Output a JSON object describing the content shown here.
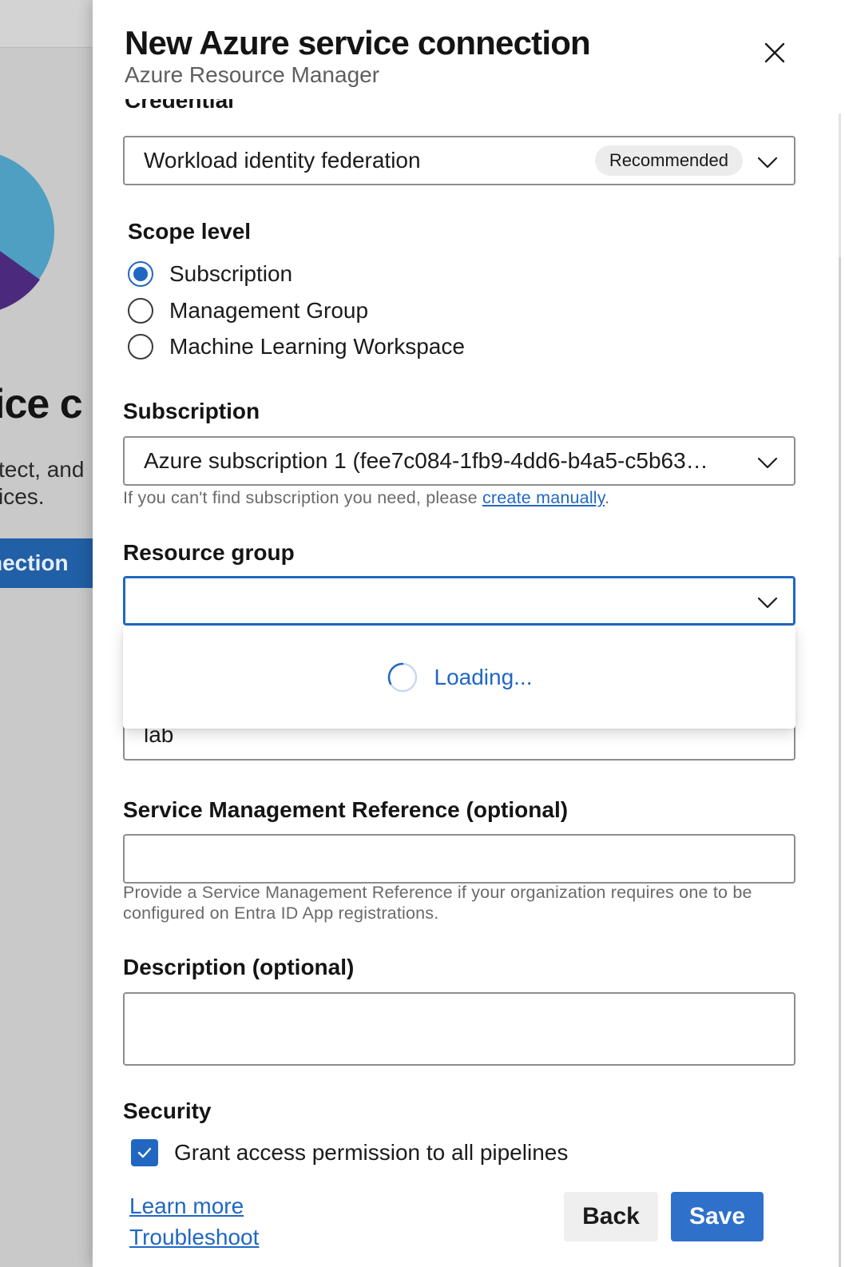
{
  "background": {
    "heading_fragment": "ice c",
    "text_line_1": "tect, and",
    "text_line_2": "ices.",
    "button_fragment": "nection"
  },
  "panel": {
    "title": "New Azure service connection",
    "subtitle": "Azure Resource Manager",
    "close_icon": "close-icon"
  },
  "credential": {
    "label": "Credential",
    "value": "Workload identity federation",
    "badge": "Recommended"
  },
  "scope": {
    "label": "Scope level",
    "options": [
      {
        "label": "Subscription",
        "checked": true
      },
      {
        "label": "Management Group",
        "checked": false
      },
      {
        "label": "Machine Learning Workspace",
        "checked": false
      }
    ]
  },
  "subscription": {
    "label": "Subscription",
    "value": "Azure subscription 1 (fee7c084-1fb9-4dd6-b4a5-c5b63…",
    "help_prefix": "If you can't find subscription you need, please ",
    "help_link": "create manually",
    "help_suffix": "."
  },
  "resource_group": {
    "label": "Resource group",
    "value": "",
    "loading_text": "Loading..."
  },
  "service_connection_name": {
    "value": "lab"
  },
  "service_management_reference": {
    "label": "Service Management Reference (optional)",
    "value": "",
    "help": "Provide a Service Management Reference if your organization requires one to be configured on Entra ID App registrations."
  },
  "description": {
    "label": "Description (optional)",
    "value": ""
  },
  "security": {
    "label": "Security",
    "checkbox_label": "Grant access permission to all pipelines",
    "checked": true
  },
  "footer": {
    "learn_more": "Learn more",
    "troubleshoot": "Troubleshoot",
    "back_label": "Back",
    "save_label": "Save"
  },
  "colors": {
    "accent": "#2167c2",
    "save_button": "#2f70cb",
    "background_button": "#215fa6"
  }
}
